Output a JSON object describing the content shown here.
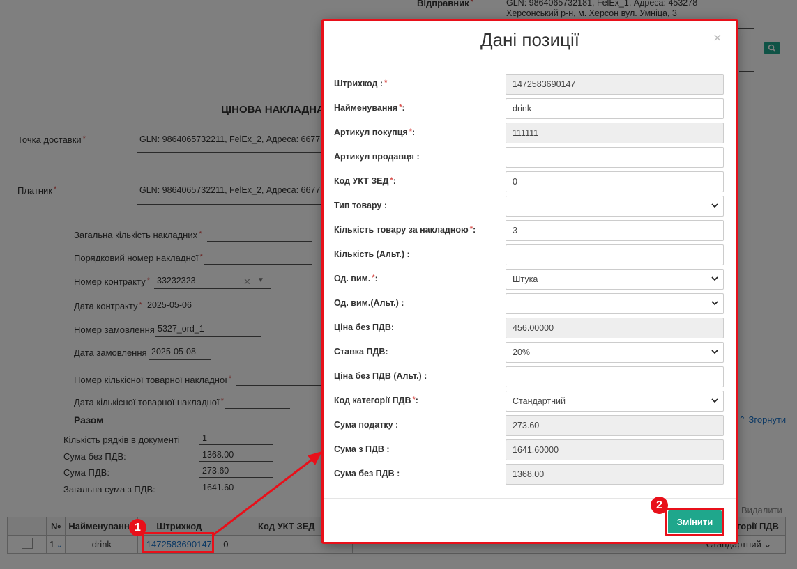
{
  "background": {
    "sender_label": "Відправник",
    "sender_value": "GLN: 9864065732181, FelEx_1, Адреса: 453278 Херсонський р-н, м. Херсон вул. Умніца, 3",
    "doc_title": "ЦІНОВА НАКЛАДНА",
    "delivery_point_label": "Точка доставки",
    "delivery_point_value": "GLN: 9864065732211, FelEx_2, Адреса: 6677",
    "payer_label": "Платник",
    "payer_value": "GLN: 9864065732211, FelEx_2, Адреса: 6677",
    "fields": [
      {
        "label": "Загальна кількість накладних",
        "value": "",
        "required": true
      },
      {
        "label": "Порядковий номер накладної",
        "value": "",
        "required": true
      },
      {
        "label": "Номер контракту",
        "value": "33232323",
        "required": true
      },
      {
        "label": "Дата контракту",
        "value": "2025-05-06",
        "required": true
      },
      {
        "label": "Номер замовлення",
        "value": "5327_ord_1",
        "required": false
      },
      {
        "label": "Дата замовлення",
        "value": "2025-05-08",
        "required": false
      },
      {
        "label": "Номер кількісної товарної накладної",
        "value": "",
        "required": true
      },
      {
        "label": "Дата кількісної товарної накладної",
        "value": "",
        "required": true
      }
    ],
    "totals_title": "Разом",
    "totals": [
      {
        "label": "Кількість рядків в документі",
        "value": "1"
      },
      {
        "label": "Сума без ПДВ:",
        "value": "1368.00"
      },
      {
        "label": "Сума ПДВ:",
        "value": "273.60"
      },
      {
        "label": "Загальна сума з ПДВ:",
        "value": "1641.60"
      }
    ],
    "collapse_link": "Згорнути",
    "delete_link": "Видалити",
    "table": {
      "headers": [
        "№",
        "Найменування",
        "Штрихкод",
        "Код УКТ ЗЕД",
        "Код категорії ПДВ"
      ],
      "row": {
        "num": "1",
        "name": "drink",
        "barcode": "1472583690147",
        "ukt": "0",
        "vat_category": "Стандартний"
      }
    }
  },
  "modal": {
    "title": "Дані позиції",
    "close": "×",
    "fields": [
      {
        "label": "Штрихкод :",
        "required": true,
        "value": "1472583690147",
        "kind": "readonly"
      },
      {
        "label": "Найменування",
        "suffix": ":",
        "required": true,
        "value": "drink",
        "kind": "input"
      },
      {
        "label": "Артикул покупця",
        "suffix": ":",
        "required": true,
        "value": "111111",
        "kind": "readonly"
      },
      {
        "label": "Артикул продавця :",
        "required": false,
        "value": "",
        "kind": "input"
      },
      {
        "label": "Код УКТ ЗЕД",
        "suffix": ":",
        "required": true,
        "value": "0",
        "kind": "input"
      },
      {
        "label": "Тип товару :",
        "required": false,
        "value": "",
        "kind": "select"
      },
      {
        "label": "Кількість товару за накладною",
        "suffix": ":",
        "required": true,
        "value": "3",
        "kind": "input"
      },
      {
        "label": "Кількість (Альт.) :",
        "required": false,
        "value": "",
        "kind": "input"
      },
      {
        "label": "Од. вим.",
        "suffix": ":",
        "required": true,
        "value": "Штука",
        "kind": "select"
      },
      {
        "label": "Од. вим.(Альт.) :",
        "required": false,
        "value": "",
        "kind": "select"
      },
      {
        "label": "Ціна без ПДВ:",
        "required": false,
        "value": "456.00000",
        "kind": "readonly"
      },
      {
        "label": "Ставка ПДВ:",
        "required": false,
        "value": "20%",
        "kind": "select"
      },
      {
        "label": "Ціна без ПДВ (Альт.) :",
        "required": false,
        "value": "",
        "kind": "input"
      },
      {
        "label": "Код категорії ПДВ",
        "suffix": ":",
        "required": true,
        "value": "Стандартний",
        "kind": "select"
      },
      {
        "label": "Сума податку :",
        "required": false,
        "value": "273.60",
        "kind": "readonly"
      },
      {
        "label": "Сума з ПДВ :",
        "required": false,
        "value": "1641.60000",
        "kind": "readonly"
      },
      {
        "label": "Сума без ПДВ :",
        "required": false,
        "value": "1368.00",
        "kind": "readonly"
      }
    ],
    "submit_label": "Змінити"
  },
  "annotations": {
    "badge1": "1",
    "badge2": "2",
    "highlight_color": "#e8101a"
  },
  "colors": {
    "accent": "#1fa78c",
    "required": "#d9534f",
    "overlay": "rgba(0,0,0,0.5)"
  }
}
